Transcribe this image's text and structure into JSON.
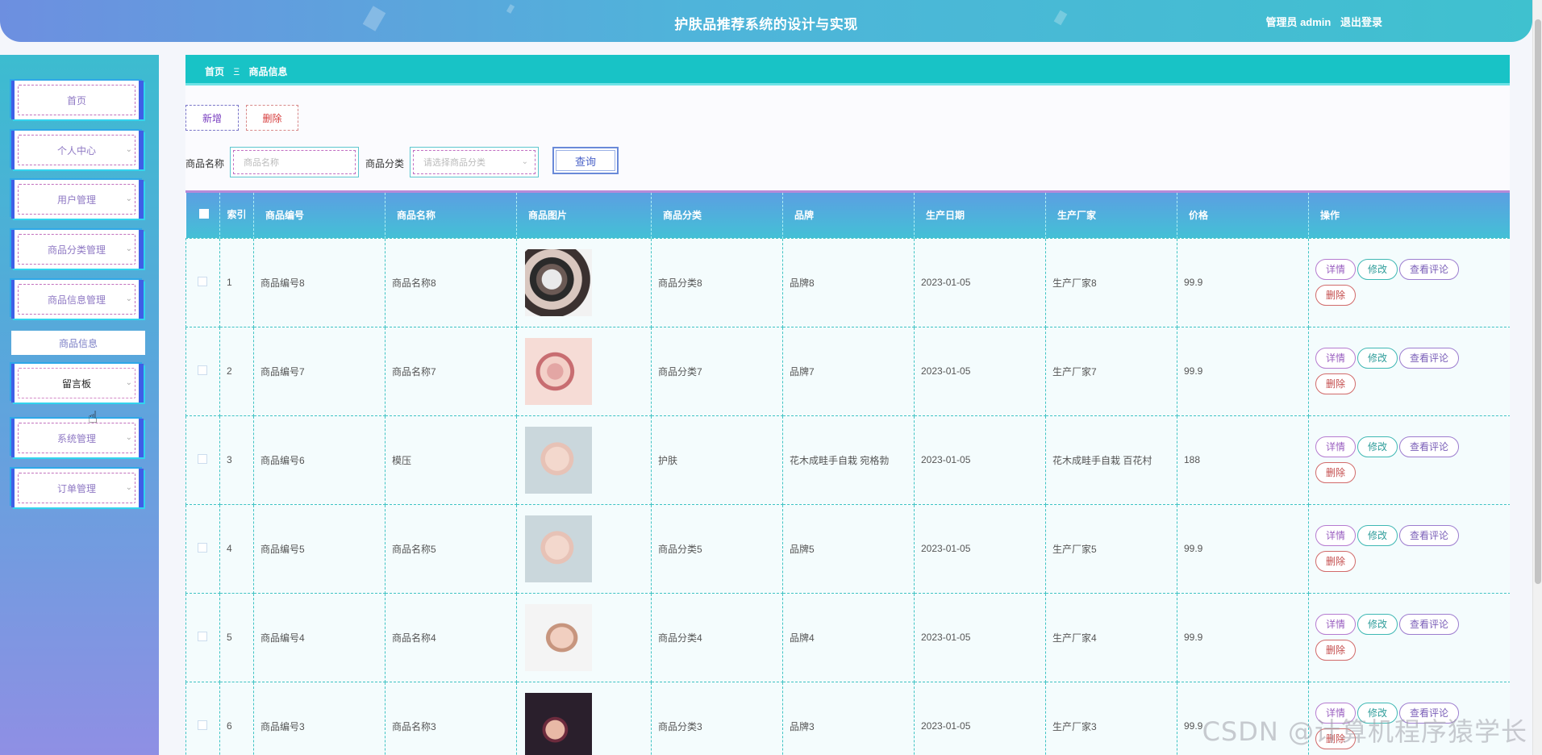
{
  "header": {
    "title": "护肤品推荐系统的设计与实现",
    "user_role": "管理员 admin",
    "logout": "退出登录"
  },
  "sidebar": {
    "items": [
      {
        "label": "首页",
        "has_arrow": false
      },
      {
        "label": "个人中心",
        "has_arrow": true
      },
      {
        "label": "用户管理",
        "has_arrow": true
      },
      {
        "label": "商品分类管理",
        "has_arrow": true
      },
      {
        "label": "商品信息管理",
        "has_arrow": true
      },
      {
        "label": "留言板",
        "has_arrow": true
      },
      {
        "label": "系统管理",
        "has_arrow": true
      },
      {
        "label": "订单管理",
        "has_arrow": true
      }
    ],
    "submenu_label": "商品信息"
  },
  "breadcrumb": {
    "home": "首页",
    "separator": "Ξ",
    "current": "商品信息"
  },
  "toolbar": {
    "add_label": "新增",
    "delete_label": "删除"
  },
  "search": {
    "name_label": "商品名称",
    "name_placeholder": "商品名称",
    "category_label": "商品分类",
    "category_placeholder": "请选择商品分类",
    "button_label": "查询"
  },
  "table": {
    "headers": [
      "索引",
      "商品编号",
      "商品名称",
      "商品图片",
      "商品分类",
      "品牌",
      "生产日期",
      "生产厂家",
      "价格",
      "操作"
    ],
    "rows": [
      {
        "index": "1",
        "code": "商品编号8",
        "name": "商品名称8",
        "image": "makeup-brushes-photo",
        "category": "商品分类8",
        "brand": "品牌8",
        "date": "2023-01-05",
        "maker": "生产厂家8",
        "price": "99.9"
      },
      {
        "index": "2",
        "code": "商品编号7",
        "name": "商品名称7",
        "image": "cosmetics-flatlay-photo",
        "category": "商品分类7",
        "brand": "品牌7",
        "date": "2023-01-05",
        "maker": "生产厂家7",
        "price": "99.9"
      },
      {
        "index": "3",
        "code": "商品编号6",
        "name": "模压",
        "image": "skincare-woman-photo",
        "category": "护肤",
        "brand": "花木成畦手自栽 宛格勃",
        "date": "2023-01-05",
        "maker": "花木成畦手自栽 百花村",
        "price": "188"
      },
      {
        "index": "4",
        "code": "商品编号5",
        "name": "商品名称5",
        "image": "skincare-woman-photo",
        "category": "商品分类5",
        "brand": "品牌5",
        "date": "2023-01-05",
        "maker": "生产厂家5",
        "price": "99.9"
      },
      {
        "index": "5",
        "code": "商品编号4",
        "name": "商品名称4",
        "image": "woman-brush-photo",
        "category": "商品分类4",
        "brand": "品牌4",
        "date": "2023-01-05",
        "maker": "生产厂家4",
        "price": "99.9"
      },
      {
        "index": "6",
        "code": "商品编号3",
        "name": "商品名称3",
        "image": "woman-lipstick-photo",
        "category": "商品分类3",
        "brand": "品牌3",
        "date": "2023-01-05",
        "maker": "生产厂家3",
        "price": "99.9"
      }
    ],
    "ops": {
      "detail": "详情",
      "edit": "修改",
      "review": "查看评论",
      "delete": "删除"
    }
  },
  "watermark": "CSDN @计算机程序猿学长"
}
